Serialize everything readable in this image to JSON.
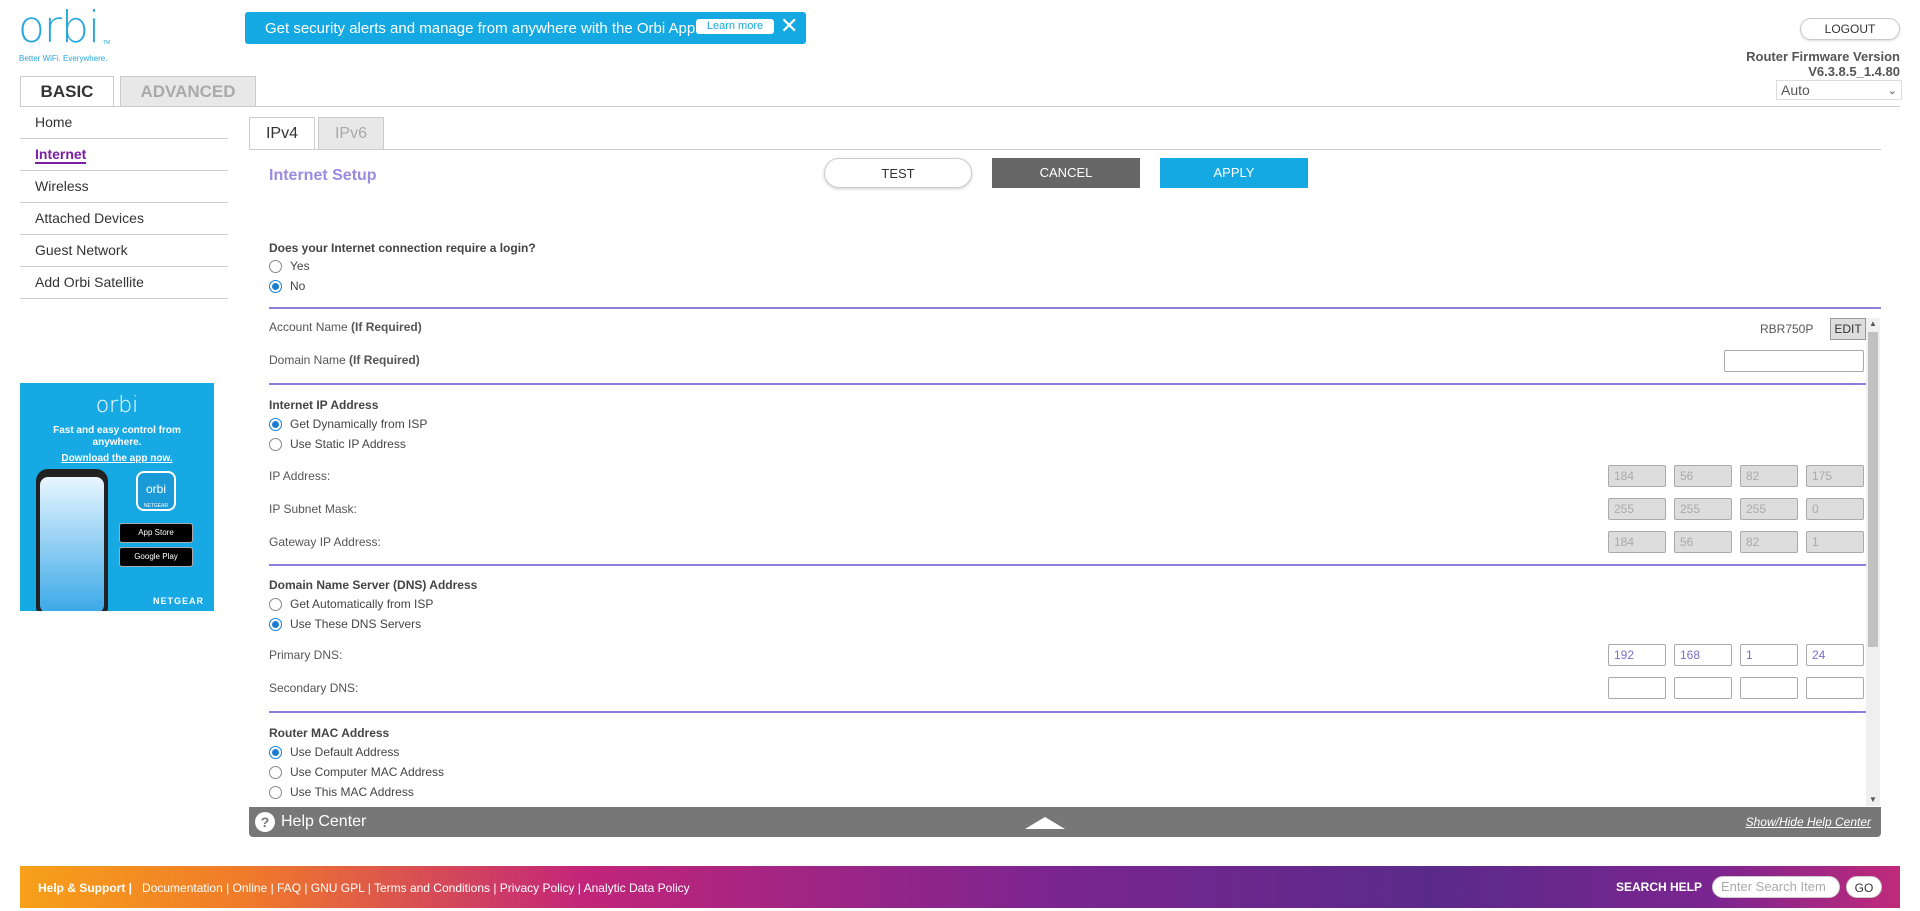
{
  "brand": {
    "logo": "orbi",
    "tm": "TM",
    "tagline": "Better WiFi. Everywhere."
  },
  "promo": {
    "text": "Get security alerts and manage from anywhere with the Orbi App.",
    "learn_more": "Learn more",
    "close_icon": "close-icon"
  },
  "header": {
    "logout": "LOGOUT",
    "firmware_label": "Router Firmware Version",
    "firmware_version": "V6.3.8.5_1.4.80",
    "language": "Auto"
  },
  "top_tabs": [
    {
      "label": "BASIC",
      "active": true
    },
    {
      "label": "ADVANCED",
      "active": false
    }
  ],
  "sidebar": {
    "items": [
      {
        "label": "Home"
      },
      {
        "label": "Internet",
        "active": true
      },
      {
        "label": "Wireless"
      },
      {
        "label": "Attached Devices"
      },
      {
        "label": "Guest Network"
      },
      {
        "label": "Add Orbi Satellite"
      }
    ]
  },
  "ad": {
    "logo": "orbi",
    "text": "Fast and easy control from anywhere.",
    "link": "Download the app now.",
    "app_label": "orbi",
    "app_sub": "NETGEAR",
    "app_store": "App Store",
    "google_play": "Google Play",
    "brand": "NETGEAR"
  },
  "sub_tabs": [
    {
      "label": "IPv4",
      "active": true
    },
    {
      "label": "IPv6",
      "active": false
    }
  ],
  "page": {
    "title": "Internet Setup"
  },
  "buttons": {
    "test": "TEST",
    "cancel": "CANCEL",
    "apply": "APPLY"
  },
  "login": {
    "question": "Does your Internet connection require a login?",
    "yes": "Yes",
    "no": "No",
    "selected": "No"
  },
  "account": {
    "label": "Account Name",
    "req": "(If Required)",
    "value": "RBR750P",
    "edit": "EDIT"
  },
  "domain": {
    "label": "Domain Name",
    "req": "(If Required)",
    "value": ""
  },
  "ip": {
    "title": "Internet IP Address",
    "opt_dynamic": "Get Dynamically from ISP",
    "opt_static": "Use Static IP Address",
    "selected": "Get Dynamically from ISP",
    "ip_label": "IP Address:",
    "mask_label": "IP Subnet Mask:",
    "gw_label": "Gateway IP Address:",
    "ip_values": [
      "184",
      "56",
      "82",
      "175"
    ],
    "mask_values": [
      "255",
      "255",
      "255",
      "0"
    ],
    "gw_values": [
      "184",
      "56",
      "82",
      "1"
    ]
  },
  "dns": {
    "title": "Domain Name Server (DNS) Address",
    "opt_auto": "Get Automatically from ISP",
    "opt_manual": "Use These DNS Servers",
    "selected": "Use These DNS Servers",
    "primary_label": "Primary DNS:",
    "secondary_label": "Secondary DNS:",
    "primary_values": [
      "192",
      "168",
      "1",
      "24"
    ],
    "secondary_values": [
      "",
      "",
      "",
      ""
    ]
  },
  "mac": {
    "title": "Router MAC Address",
    "opt_default": "Use Default Address",
    "opt_computer": "Use Computer MAC Address",
    "opt_this": "Use This MAC Address",
    "selected": "Use Default Address"
  },
  "help": {
    "title": "Help Center",
    "toggle": "Show/Hide Help Center"
  },
  "footer": {
    "help_support": "Help & Support |",
    "links": "Documentation | Online | FAQ | GNU GPL | Terms and Conditions | Privacy Policy | Analytic Data Policy",
    "search_label": "SEARCH HELP",
    "search_placeholder": "Enter Search Item",
    "go": "GO"
  }
}
